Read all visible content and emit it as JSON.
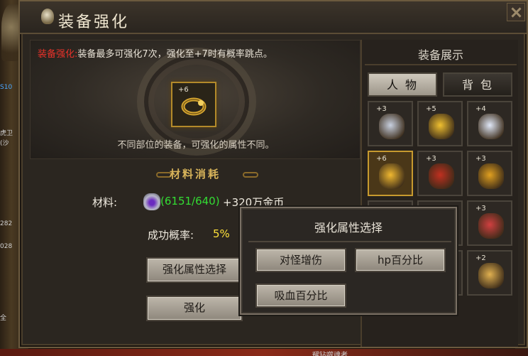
{
  "window": {
    "title": "装备强化"
  },
  "notice": {
    "prefix": "装备强化:",
    "text": "装备最多可强化7次，强化至+7时有概率跳点。"
  },
  "selected_item": {
    "level": "+6",
    "hint": "不同部位的装备，可强化的属性不同。"
  },
  "materials": {
    "section_title": "材料消耗",
    "label": "材料:",
    "count": "(6151/640)",
    "gold": "+320万金币"
  },
  "success": {
    "label": "成功概率:",
    "value": "5%"
  },
  "buttons": {
    "select_attr": "强化属性选择",
    "enhance": "强化"
  },
  "showcase": {
    "title": "装备展示",
    "tabs": [
      "人物",
      "背包"
    ],
    "slots": [
      {
        "level": "+3",
        "icon": "helmet-icon",
        "color": "#c8d0e0"
      },
      {
        "level": "+5",
        "icon": "sword-icon",
        "color": "#f0c030"
      },
      {
        "level": "+4",
        "icon": "necklace-icon",
        "color": "#e0e8f8"
      },
      {
        "level": "+6",
        "icon": "ring-icon",
        "color": "#f0b830",
        "selected": true
      },
      {
        "level": "+3",
        "icon": "armor-icon",
        "color": "#c03020"
      },
      {
        "level": "+3",
        "icon": "bracelet-icon",
        "color": "#e0a020"
      },
      {
        "level": "",
        "icon": "",
        "color": ""
      },
      {
        "level": "",
        "icon": "",
        "color": ""
      },
      {
        "level": "+3",
        "icon": "ring-icon",
        "color": "#d04040"
      },
      {
        "level": "",
        "icon": "",
        "color": ""
      },
      {
        "level": "",
        "icon": "",
        "color": ""
      },
      {
        "level": "+2",
        "icon": "book-icon",
        "color": "#e0b050"
      }
    ]
  },
  "popup": {
    "title": "强化属性选择",
    "options": [
      "对怪增伤",
      "hp百分比",
      "吸血百分比"
    ]
  },
  "side_texts": [
    "S10",
    "虎卫",
    "(沙",
    "282",
    "028",
    "全"
  ],
  "bottom_text": "耀钻噬魂者"
}
